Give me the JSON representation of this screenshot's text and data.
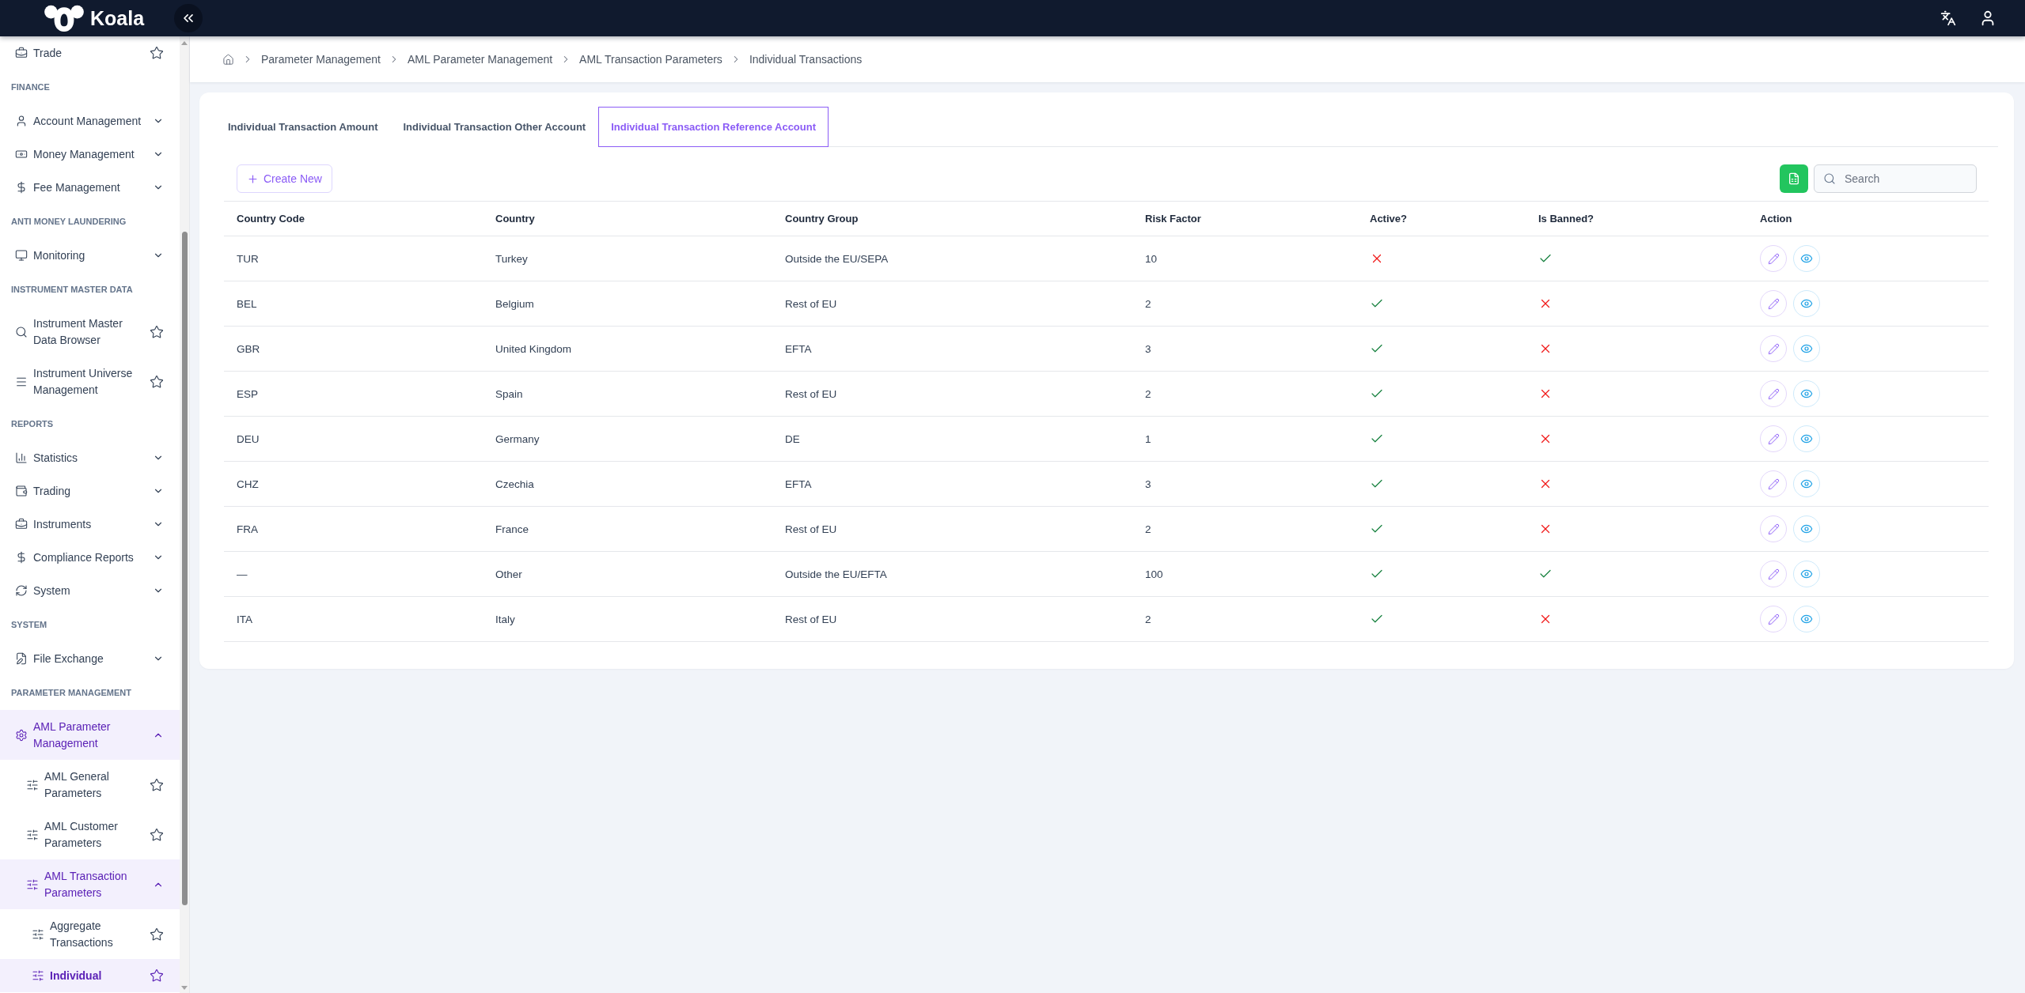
{
  "top_bar": {
    "logo": "Koala"
  },
  "sidebar": {
    "items": [
      {
        "kind": "link",
        "label": "Trade",
        "starred": false,
        "selected": false
      },
      {
        "kind": "heading",
        "label": "FINANCE"
      },
      {
        "kind": "group",
        "label": "Account Management",
        "expanded": false,
        "selected": false
      },
      {
        "kind": "group",
        "label": "Money Management",
        "expanded": false,
        "selected": false
      },
      {
        "kind": "group",
        "label": "Fee Management",
        "expanded": false,
        "selected": false
      },
      {
        "kind": "heading",
        "label": "ANTI MONEY LAUNDERING"
      },
      {
        "kind": "group",
        "label": "Monitoring",
        "expanded": false,
        "selected": false
      },
      {
        "kind": "heading",
        "label": "INSTRUMENT MASTER DATA"
      },
      {
        "kind": "link",
        "label": "Instrument Master Data Browser",
        "starred": false,
        "selected": false
      },
      {
        "kind": "link",
        "label": "Instrument Universe Management",
        "starred": false,
        "selected": false
      },
      {
        "kind": "heading",
        "label": "REPORTS"
      },
      {
        "kind": "group",
        "label": "Statistics",
        "expanded": false,
        "selected": false
      },
      {
        "kind": "group",
        "label": "Trading",
        "expanded": false,
        "selected": false
      },
      {
        "kind": "group",
        "label": "Instruments",
        "expanded": false,
        "selected": false
      },
      {
        "kind": "group",
        "label": "Compliance Reports",
        "expanded": false,
        "selected": false
      },
      {
        "kind": "group",
        "label": "System",
        "expanded": false,
        "selected": false
      },
      {
        "kind": "heading",
        "label": "SYSTEM"
      },
      {
        "kind": "group",
        "label": "File Exchange",
        "expanded": false,
        "selected": false
      },
      {
        "kind": "heading",
        "label": "PARAMETER MANAGEMENT"
      },
      {
        "kind": "group",
        "label": "AML Parameter Management",
        "expanded": true,
        "selected": true,
        "children": [
          {
            "kind": "link",
            "label": "AML General Parameters",
            "starred": false,
            "selected": false
          },
          {
            "kind": "link",
            "label": "AML Customer Parameters",
            "starred": false,
            "selected": false
          },
          {
            "kind": "group",
            "label": "AML Transaction Parameters",
            "expanded": true,
            "selected": true,
            "children": [
              {
                "kind": "link",
                "label": "Aggregate Transactions",
                "starred": false,
                "selected": false
              },
              {
                "kind": "link",
                "label": "Individual",
                "starred": false,
                "selected": true
              }
            ]
          }
        ]
      }
    ]
  },
  "breadcrumb": [
    "Parameter Management",
    "AML Parameter Management",
    "AML Transaction Parameters",
    "Individual Transactions"
  ],
  "tabs": [
    {
      "label": "Individual Transaction Amount",
      "selected": false
    },
    {
      "label": "Individual Transaction Other Account",
      "selected": false
    },
    {
      "label": "Individual Transaction Reference Account",
      "selected": true
    }
  ],
  "toolbar": {
    "create_button": "Create New",
    "search": {
      "placeholder": "Search"
    }
  },
  "table": {
    "columns": [
      "Country Code",
      "Country",
      "Country Group",
      "Risk Factor",
      "Active?",
      "Is Banned?",
      "Action"
    ],
    "rows": [
      {
        "country_code": "TUR",
        "country": "Turkey",
        "country_group": "Outside the EU/SEPA",
        "risk_factor": "10",
        "active": false,
        "banned": true
      },
      {
        "country_code": "BEL",
        "country": "Belgium",
        "country_group": "Rest of EU",
        "risk_factor": "2",
        "active": true,
        "banned": false
      },
      {
        "country_code": "GBR",
        "country": "United Kingdom",
        "country_group": "EFTA",
        "risk_factor": "3",
        "active": true,
        "banned": false
      },
      {
        "country_code": "ESP",
        "country": "Spain",
        "country_group": "Rest of EU",
        "risk_factor": "2",
        "active": true,
        "banned": false
      },
      {
        "country_code": "DEU",
        "country": "Germany",
        "country_group": "DE",
        "risk_factor": "1",
        "active": true,
        "banned": false
      },
      {
        "country_code": "CHZ",
        "country": "Czechia",
        "country_group": "EFTA",
        "risk_factor": "3",
        "active": true,
        "banned": false
      },
      {
        "country_code": "FRA",
        "country": "France",
        "country_group": "Rest of EU",
        "risk_factor": "2",
        "active": true,
        "banned": false
      },
      {
        "country_code": "—",
        "country": "Other",
        "country_group": "Outside the EU/EFTA",
        "risk_factor": "100",
        "active": true,
        "banned": true
      },
      {
        "country_code": "ITA",
        "country": "Italy",
        "country_group": "Rest of EU",
        "risk_factor": "2",
        "active": true,
        "banned": false
      }
    ]
  }
}
